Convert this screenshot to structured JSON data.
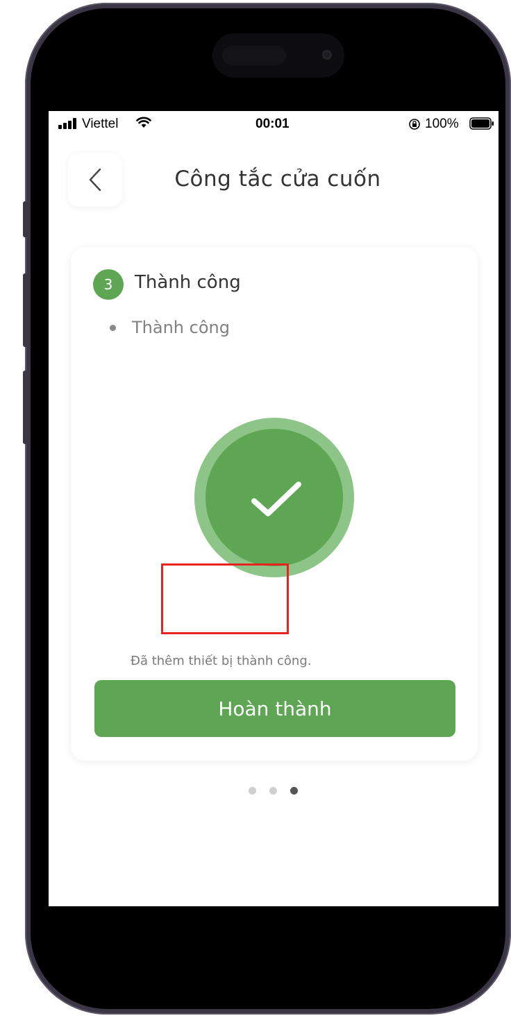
{
  "status_bar": {
    "carrier": "Viettel",
    "time": "00:01",
    "battery_percent": "100%",
    "icons": [
      "signal-icon",
      "wifi-icon",
      "orientation-lock-icon",
      "battery-icon"
    ]
  },
  "header": {
    "back_icon": "chevron-left-icon",
    "title": "Công tắc cửa cuốn"
  },
  "step": {
    "number": "3",
    "title": "Thành công",
    "detail": "Thành công"
  },
  "result": {
    "icon": "checkmark-icon",
    "message": "Đã thêm thiết bị thành công."
  },
  "actions": {
    "done_label": "Hoàn thành"
  },
  "pager": {
    "total": 3,
    "active_index": 2
  },
  "colors": {
    "accent": "#5ea654",
    "accent_light": "#8cc587",
    "highlight": "#e8221f",
    "frame": "#3a3646"
  }
}
